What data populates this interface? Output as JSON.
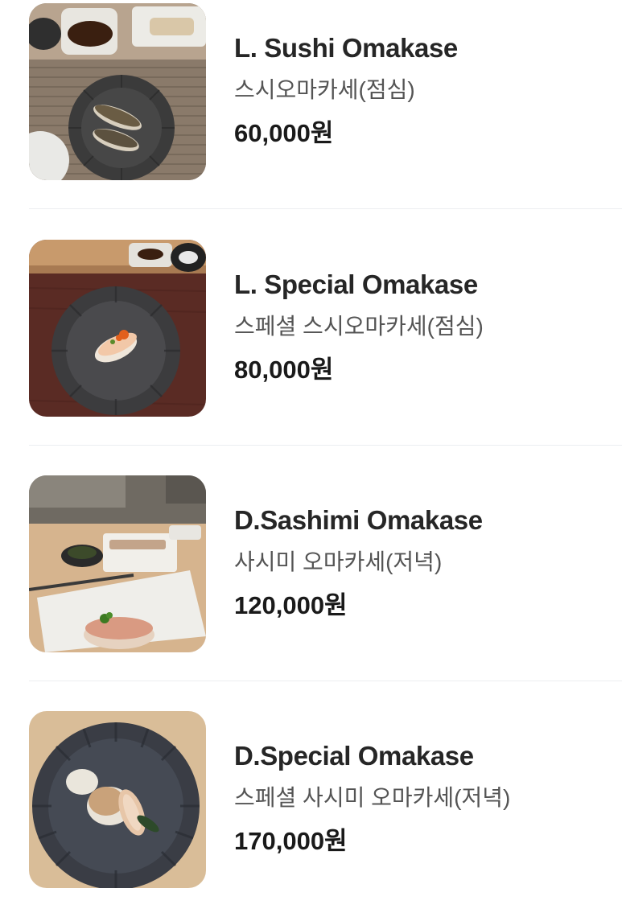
{
  "menu": {
    "items": [
      {
        "name": "L. Sushi Omakase",
        "subtitle": "스시오마카세(점심)",
        "price": "60,000원",
        "photo_alt": "Sushi omakase lunch course photo"
      },
      {
        "name": "L. Special Omakase",
        "subtitle": "스페셜 스시오마카세(점심)",
        "price": "80,000원",
        "photo_alt": "Special sushi omakase lunch course photo"
      },
      {
        "name": "D.Sashimi Omakase",
        "subtitle": "사시미 오마카세(저녁)",
        "price": "120,000원",
        "photo_alt": "Sashimi omakase dinner course photo"
      },
      {
        "name": "D.Special Omakase",
        "subtitle": "스페셜 사시미 오마카세(저녁)",
        "price": "170,000원",
        "photo_alt": "Special sashimi omakase dinner course photo"
      }
    ]
  },
  "colors": {
    "title_text": "#262626",
    "subtitle_text": "#545454",
    "price_text": "#1a1a1a",
    "divider": "#eceef1"
  }
}
